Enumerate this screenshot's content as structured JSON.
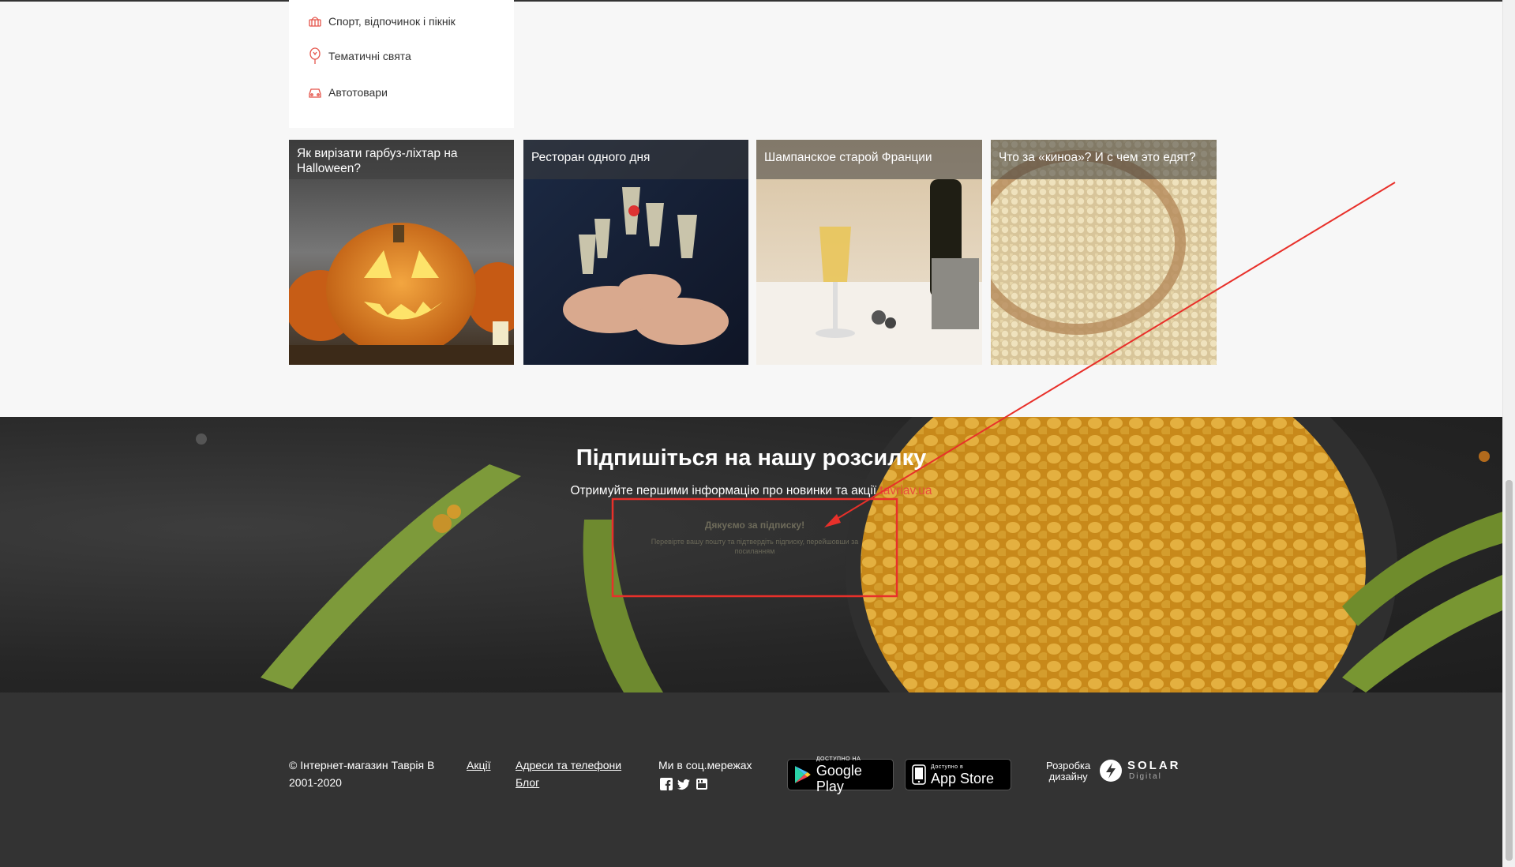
{
  "categories": [
    {
      "label": "Спорт, відпочинок і пікнік",
      "icon": "picnic-basket-icon"
    },
    {
      "label": "Тематичні свята",
      "icon": "balloon-icon"
    },
    {
      "label": "Автотовари",
      "icon": "car-icon"
    }
  ],
  "articles": [
    {
      "title": "Як вирізати гарбуз-ліхтар на Halloween?"
    },
    {
      "title": "Ресторан одного дня"
    },
    {
      "title": "Шампанское старой Франции"
    },
    {
      "title": "Что за «киноа»? И с чем это едят?"
    }
  ],
  "subscribe": {
    "title": "Підпишіться на нашу розсилку",
    "text": "Отримуйте першими інформацію про новинки та акції",
    "link_text": "tavriav.ua",
    "thanks_title": "Дякуємо за підписку!",
    "thanks_text": "Перевірте вашу пошту та підтвердіть підписку, перейшовши за посиланням"
  },
  "footer": {
    "copyright_line1": "© Інтернет-магазин Таврія В",
    "copyright_line2": "2001-2020",
    "promo_link": "Акції",
    "addresses_link": "Адреси та телефони",
    "blog_link": "Блог",
    "social_label": "Ми в соц.мережах",
    "google_play_small": "ДОСТУПНО НА",
    "google_play_big": "Google Play",
    "app_store_small": "Доступно в",
    "app_store_big": "App Store",
    "dev_label_1": "Розробка",
    "dev_label_2": "дизайну",
    "solar_name": "SOLAR",
    "solar_sub": "Digital"
  },
  "colors": {
    "annotation_red": "#e8302a",
    "link_red": "#e94b3c",
    "footer_bg": "#333333"
  }
}
